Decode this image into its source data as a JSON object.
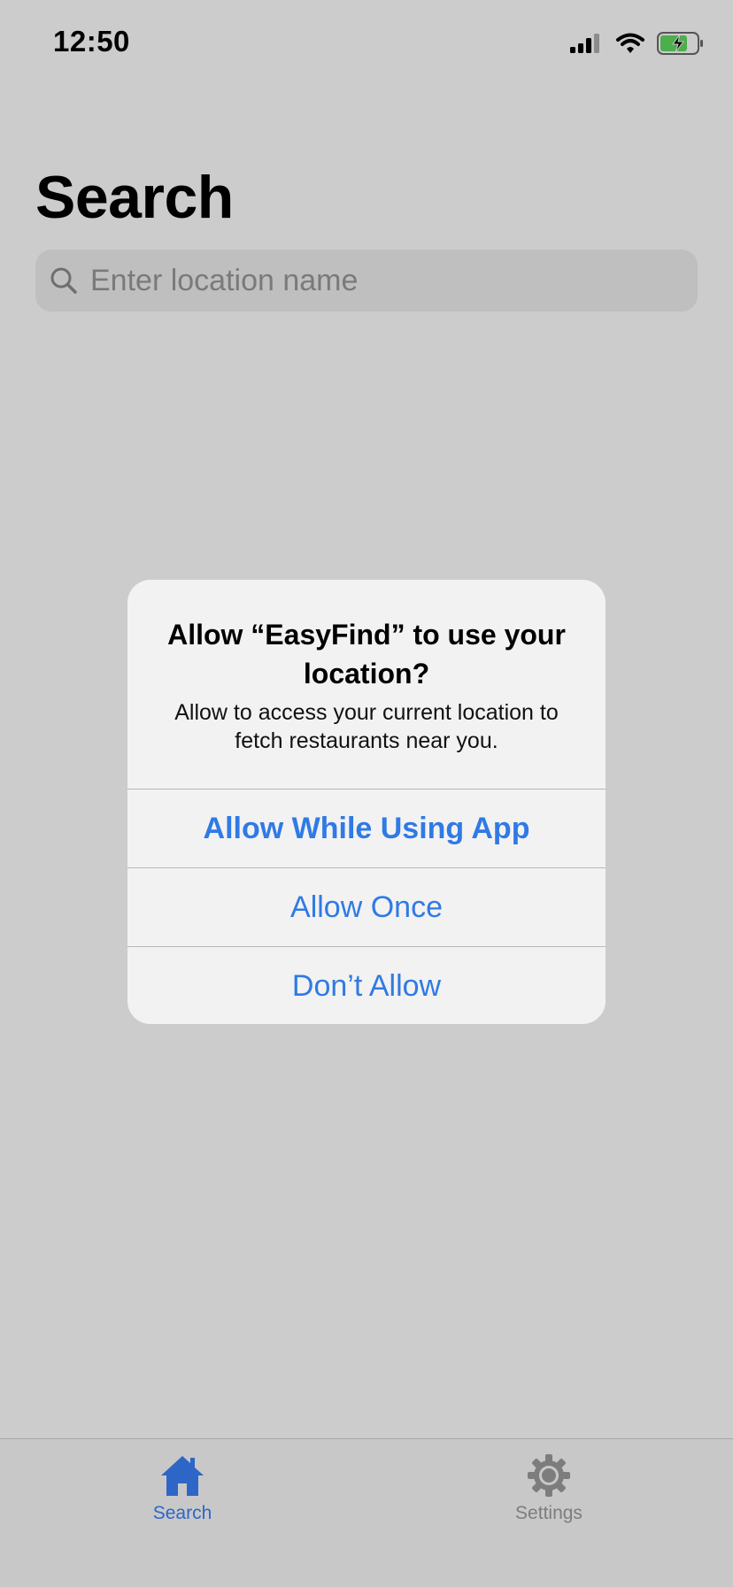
{
  "status_bar": {
    "time": "12:50",
    "icons": [
      "cellular-signal-icon",
      "wifi-icon",
      "battery-charging-icon"
    ]
  },
  "page": {
    "title": "Search"
  },
  "search": {
    "placeholder": "Enter location name",
    "icon": "search-icon"
  },
  "alert": {
    "title": "Allow “EasyFind” to use your location?",
    "message": "Allow to access your current location to fetch restaurants near you.",
    "buttons": [
      {
        "label": "Allow While Using App"
      },
      {
        "label": "Allow Once"
      },
      {
        "label": "Don’t Allow"
      }
    ]
  },
  "tab_bar": {
    "items": [
      {
        "label": "Search",
        "icon": "home-icon",
        "selected": true
      },
      {
        "label": "Settings",
        "icon": "gear-icon",
        "selected": false
      }
    ]
  },
  "colors": {
    "accent": "#2f7ae5",
    "tab_active": "#2e66c8",
    "tab_inactive": "#7d7d7d",
    "battery_fill": "#4cae4c"
  }
}
